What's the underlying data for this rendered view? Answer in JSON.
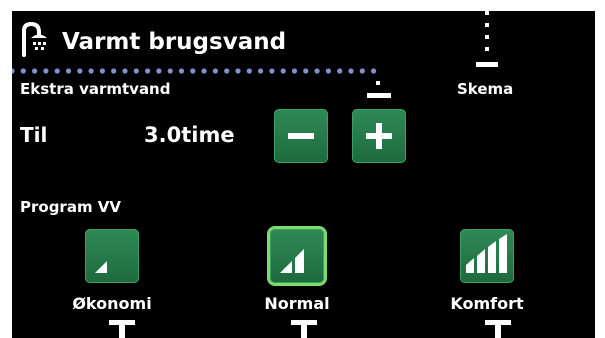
{
  "header": {
    "title": "Varmt brugsvand",
    "icon": "shower-icon"
  },
  "nav": {
    "schedule_label": "Skema",
    "schedule_icon": "clock-icon"
  },
  "extra_hot_water": {
    "heading": "Ekstra varmtvand",
    "label": "Til",
    "value": "3.0time",
    "minus_icon": "minus-icon",
    "plus_icon": "plus-icon"
  },
  "program": {
    "heading": "Program VV",
    "options": [
      {
        "label": "Økonomi",
        "icon": "signal-1-icon",
        "level": 1,
        "selected": false
      },
      {
        "label": "Normal",
        "icon": "signal-2-icon",
        "level": 2,
        "selected": true
      },
      {
        "label": "Komfort",
        "icon": "signal-3-icon",
        "level": 3,
        "selected": false
      }
    ]
  },
  "colors": {
    "background": "#000000",
    "button_green": "#2a7d4c",
    "selected_outline": "#7cdc6c",
    "text": "#ffffff",
    "dots": "#8090d0"
  }
}
